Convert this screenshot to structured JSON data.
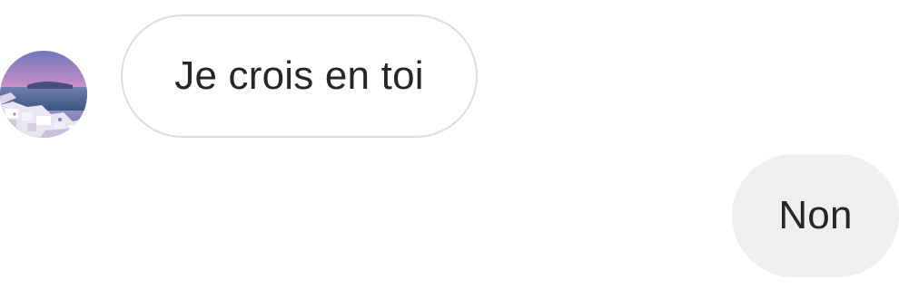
{
  "conversation": {
    "messages": [
      {
        "direction": "received",
        "text": "Je crois en toi",
        "has_avatar": true
      },
      {
        "direction": "sent",
        "text": "Non"
      }
    ]
  },
  "colors": {
    "received_border": "#dedede",
    "received_background": "#ffffff",
    "sent_background": "#efefef",
    "text": "#262626"
  },
  "icons": {
    "avatar": "profile-photo-santorini-sunset"
  }
}
